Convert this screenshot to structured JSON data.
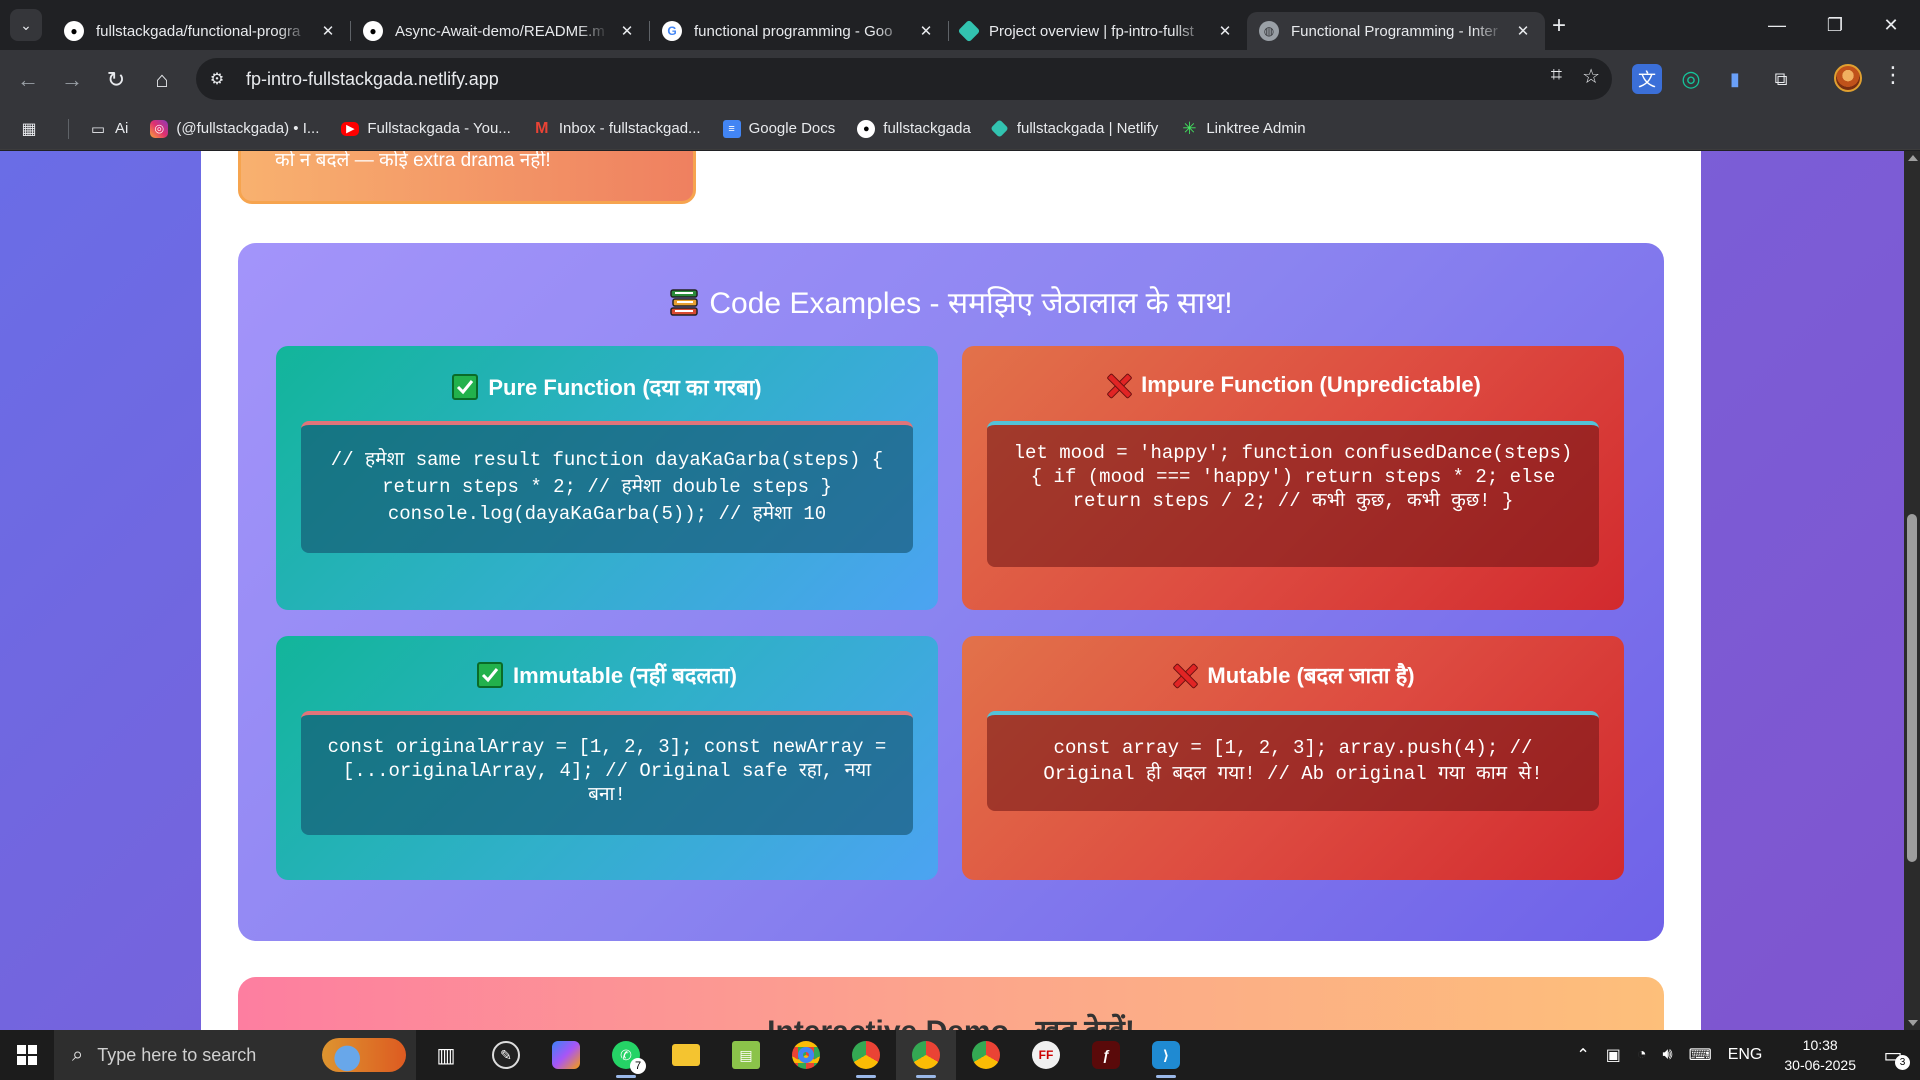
{
  "browser": {
    "tabs": [
      {
        "title": "fullstackgada/functional-progra",
        "icon": "github-icon"
      },
      {
        "title": "Async-Await-demo/README.m",
        "icon": "github-icon"
      },
      {
        "title": "functional programming - Goo",
        "icon": "google-icon"
      },
      {
        "title": "Project overview | fp-intro-fullst",
        "icon": "netlify-icon"
      },
      {
        "title": "Functional Programming - Inter",
        "icon": "globe-icon",
        "active": true
      }
    ],
    "close_glyph": "✕",
    "new_tab_glyph": "+",
    "url": "fp-intro-fullstackgada.netlify.app",
    "bookmarks": [
      {
        "label": "Ai",
        "icon": "folder-icon"
      },
      {
        "label": "(@fullstackgada) • I...",
        "icon": "instagram-icon"
      },
      {
        "label": "Fullstackgada - You...",
        "icon": "youtube-icon"
      },
      {
        "label": "Inbox - fullstackgad...",
        "icon": "gmail-icon"
      },
      {
        "label": "Google Docs",
        "icon": "google-docs-icon"
      },
      {
        "label": "fullstackgada",
        "icon": "github-icon"
      },
      {
        "label": "fullstackgada | Netlify",
        "icon": "netlify-icon"
      },
      {
        "label": "Linktree Admin",
        "icon": "linktree-icon"
      }
    ]
  },
  "page": {
    "prev_card_text": "को न बदले — कोई extra drama नहीं!",
    "examples_title": "Code Examples - समझिए जेठालाल के साथ!",
    "cards": [
      {
        "kind": "good",
        "title": "Pure Function (दया का गरबा)",
        "code": "// हमेशा same result function dayaKaGarba(steps) { return steps * 2; // हमेशा double steps } console.log(dayaKaGarba(5)); // हमेशा 10"
      },
      {
        "kind": "bad",
        "title": "Impure Function (Unpredictable)",
        "code": "let mood = 'happy'; function confusedDance(steps) { if (mood === 'happy') return steps * 2; else return steps / 2; // कभी कुछ, कभी कुछ! }"
      },
      {
        "kind": "good",
        "title": "Immutable (नहीं बदलता)",
        "code": "const originalArray = [1, 2, 3]; const newArray = [...originalArray, 4]; // Original safe रहा, नया बना!"
      },
      {
        "kind": "bad",
        "title": "Mutable (बदल जाता है)",
        "code": "const array = [1, 2, 3]; array.push(4); // Original ही बदल गया! // Ab original गया काम से!"
      }
    ],
    "next_card_title": "Interactive Demo - खुद देखें!"
  },
  "taskbar": {
    "search_placeholder": "Type here to search",
    "whatsapp_badge": "7",
    "language": "ENG",
    "time": "10:38",
    "date": "30-06-2025",
    "notification_count": "3"
  },
  "colors": {
    "good_gradient_start": "#12b59a",
    "good_gradient_end": "#4ca3f2",
    "bad_gradient_start": "#e2724a",
    "bad_gradient_end": "#d22a2e",
    "section_gradient_start": "#a394fa",
    "section_gradient_end": "#6f62e8"
  }
}
